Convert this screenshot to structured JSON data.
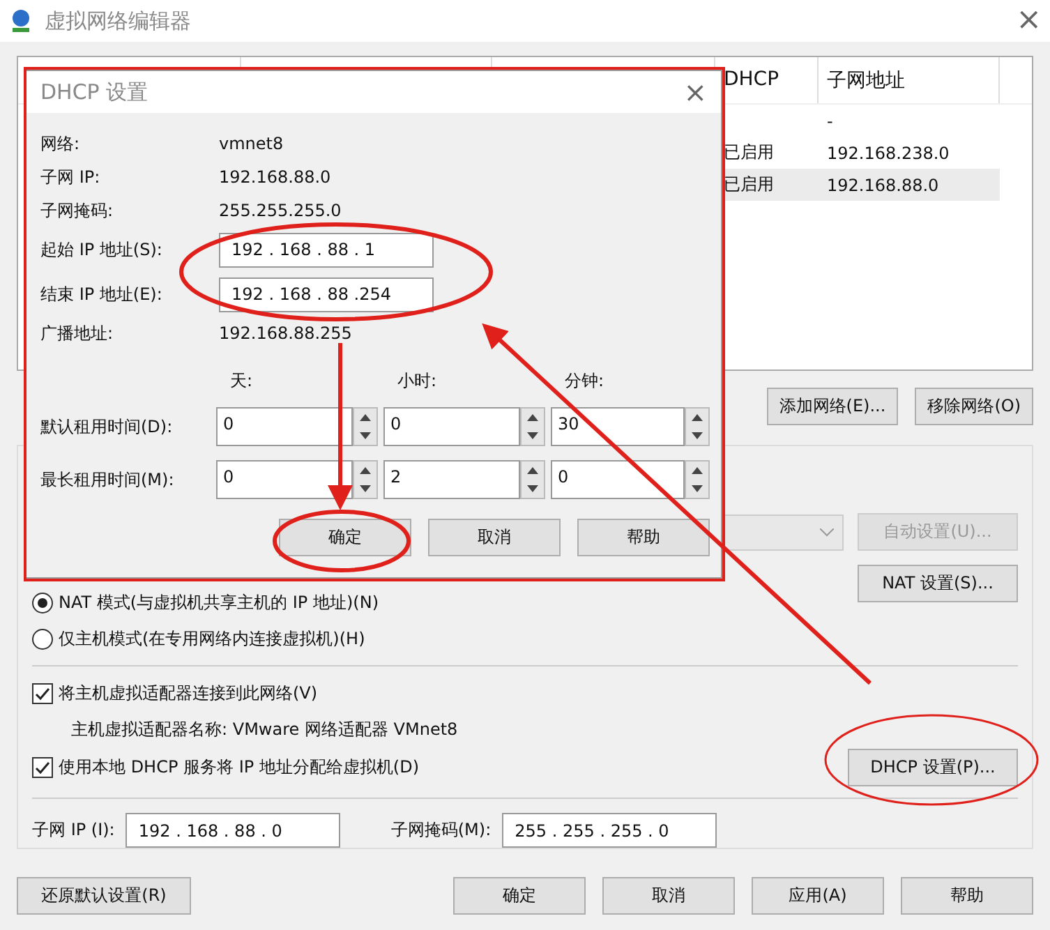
{
  "window": {
    "title": "虚拟网络编辑器",
    "close": "×"
  },
  "network_list": {
    "columns": [
      "DHCP",
      "子网地址"
    ],
    "rows": [
      {
        "subnet": "-",
        "selected": false
      },
      {
        "dhcp": "已启用",
        "subnet": "192.168.238.0",
        "selected": false
      },
      {
        "dhcp": "已启用",
        "subnet": "192.168.88.0",
        "selected": true
      }
    ]
  },
  "list_buttons": [
    "添加网络(E)...",
    "移除网络(O)"
  ],
  "nat": {
    "auto_button": {
      "label": "自动设置(U)...",
      "disabled": true
    },
    "settings_button": "NAT 设置(S)..."
  },
  "modes": [
    {
      "label": "NAT 模式(与虚拟机共享主机的 IP 地址)(N)",
      "selected": true
    },
    {
      "label": "仅主机模式(在专用网络内连接虚拟机)(H)",
      "selected": false
    }
  ],
  "connect_adapter": {
    "label": "将主机虚拟适配器连接到此网络(V)",
    "checked": true
  },
  "adapter_name": "主机虚拟适配器名称: VMware 网络适配器 VMnet8",
  "use_dhcp": {
    "label": "使用本地 DHCP 服务将 IP 地址分配给虚拟机(D)",
    "checked": true
  },
  "dhcp_button": "DHCP 设置(P)...",
  "subnet_ip": {
    "label": "子网 IP (I):",
    "value": "192 . 168 . 88 . 0"
  },
  "subnet_mask": {
    "label": "子网掩码(M):",
    "value": "255 . 255 . 255 . 0"
  },
  "bottom_buttons": [
    {
      "label": "还原默认设置(R)"
    },
    {
      "label": "确定"
    },
    {
      "label": "取消"
    },
    {
      "label": "应用(A)"
    },
    {
      "label": "帮助"
    }
  ],
  "dhcp_dialog": {
    "title": "DHCP 设置",
    "close": "×",
    "info": [
      {
        "label": "网络:",
        "value": "vmnet8"
      },
      {
        "label": "子网 IP:",
        "value": "192.168.88.0"
      },
      {
        "label": "子网掩码:",
        "value": "255.255.255.0"
      }
    ],
    "start_ip": {
      "label": "起始 IP 地址(S):",
      "value": "192 . 168 . 88 . 1"
    },
    "end_ip": {
      "label": "结束 IP 地址(E):",
      "value": "192 . 168 . 88 .254"
    },
    "broadcast": {
      "label": "广播地址:",
      "value": "192.168.88.255"
    },
    "lease_columns": [
      "天:",
      "小时:",
      "分钟:"
    ],
    "leases": [
      {
        "label": "默认租用时间(D):",
        "values": [
          "0",
          "0",
          "30"
        ]
      },
      {
        "label": "最长租用时间(M):",
        "values": [
          "0",
          "2",
          "0"
        ]
      }
    ],
    "buttons": [
      "确定",
      "取消",
      "帮助"
    ]
  }
}
